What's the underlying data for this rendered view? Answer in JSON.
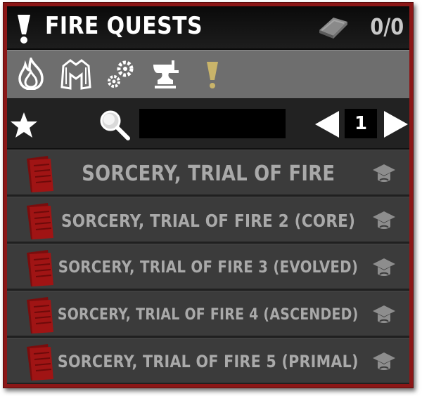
{
  "header": {
    "title": "FIRE QUESTS",
    "count": "0/0",
    "icons": [
      "exclamation-icon",
      "book-icon"
    ]
  },
  "categories": [
    {
      "name": "fire-icon",
      "active": false
    },
    {
      "name": "armor-icon",
      "active": false
    },
    {
      "name": "gears-icon",
      "active": false
    },
    {
      "name": "anvil-icon",
      "active": false
    },
    {
      "name": "exclamation-icon",
      "active": true
    }
  ],
  "filter": {
    "search_value": "",
    "page": "1",
    "icons": [
      "star-icon",
      "magnifier-icon",
      "left-arrow-icon",
      "right-arrow-icon"
    ]
  },
  "quests": [
    {
      "title": "SORCERY, TRIAL OF FIRE"
    },
    {
      "title": "SORCERY, TRIAL OF FIRE 2 (CORE)"
    },
    {
      "title": "SORCERY, TRIAL OF FIRE 3 (EVOLVED)"
    },
    {
      "title": "SORCERY, TRIAL OF FIRE 4 (ASCENDED)"
    },
    {
      "title": "SORCERY, TRIAL OF FIRE 5 (PRIMAL)"
    }
  ],
  "colors": {
    "frame": "#8b1717",
    "header_bg": "#0a0a0a",
    "category_bar": "#6e6e6e",
    "row_bg": "#3b3b3b",
    "row_text": "#a9a9a9",
    "active_category": "#c9b46a",
    "scroll_red": "#a01414"
  }
}
